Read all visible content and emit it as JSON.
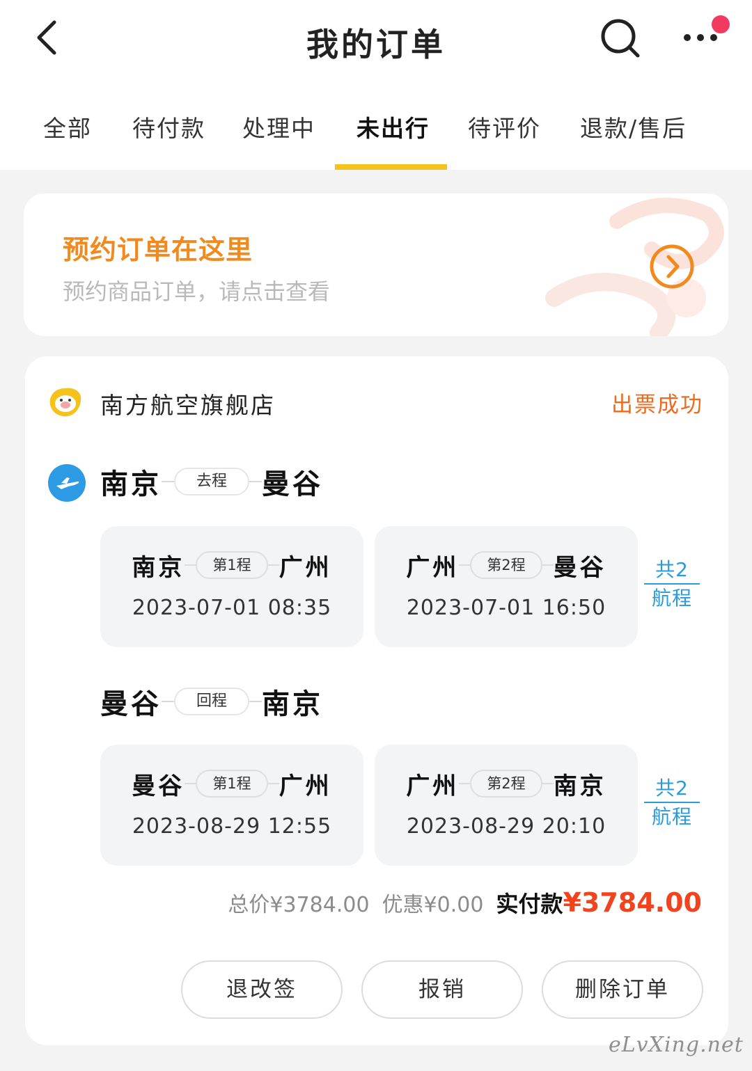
{
  "header": {
    "title": "我的订单",
    "back_icon": "chevron-left-icon",
    "search_icon": "search-icon",
    "more_icon": "more-dots-icon"
  },
  "tabs": [
    {
      "label": "全部",
      "active": false
    },
    {
      "label": "待付款",
      "active": false
    },
    {
      "label": "处理中",
      "active": false
    },
    {
      "label": "未出行",
      "active": true
    },
    {
      "label": "待评价",
      "active": false
    },
    {
      "label": "退款/售后",
      "active": false
    }
  ],
  "reservation": {
    "title": "预约订单在这里",
    "subtitle": "预约商品订单，请点击查看"
  },
  "order": {
    "shop_name": "南方航空旗舰店",
    "status": "出票成功",
    "outbound": {
      "from": "南京",
      "tag": "去程",
      "to": "曼谷",
      "segments": [
        {
          "from": "南京",
          "tag": "第1程",
          "to": "广州",
          "time": "2023-07-01 08:35"
        },
        {
          "from": "广州",
          "tag": "第2程",
          "to": "曼谷",
          "time": "2023-07-01 16:50"
        }
      ],
      "total_line1": "共2",
      "total_line2": "航程"
    },
    "return": {
      "from": "曼谷",
      "tag": "回程",
      "to": "南京",
      "segments": [
        {
          "from": "曼谷",
          "tag": "第1程",
          "to": "广州",
          "time": "2023-08-29 12:55"
        },
        {
          "from": "广州",
          "tag": "第2程",
          "to": "南京",
          "time": "2023-08-29 20:10"
        }
      ],
      "total_line1": "共2",
      "total_line2": "航程"
    },
    "price": {
      "total": "总价¥3784.00",
      "discount": "优惠¥0.00",
      "paid_label": "实付款",
      "paid_value": "¥3784.00"
    },
    "buttons": {
      "change": "退改签",
      "reimburse": "报销",
      "delete": "删除订单"
    }
  },
  "watermark": "eLvXing.net",
  "colors": {
    "accent_yellow": "#f6c21c",
    "status_orange": "#ef6a1b",
    "price_red": "#f0431e",
    "link_blue": "#2a9bd8"
  }
}
